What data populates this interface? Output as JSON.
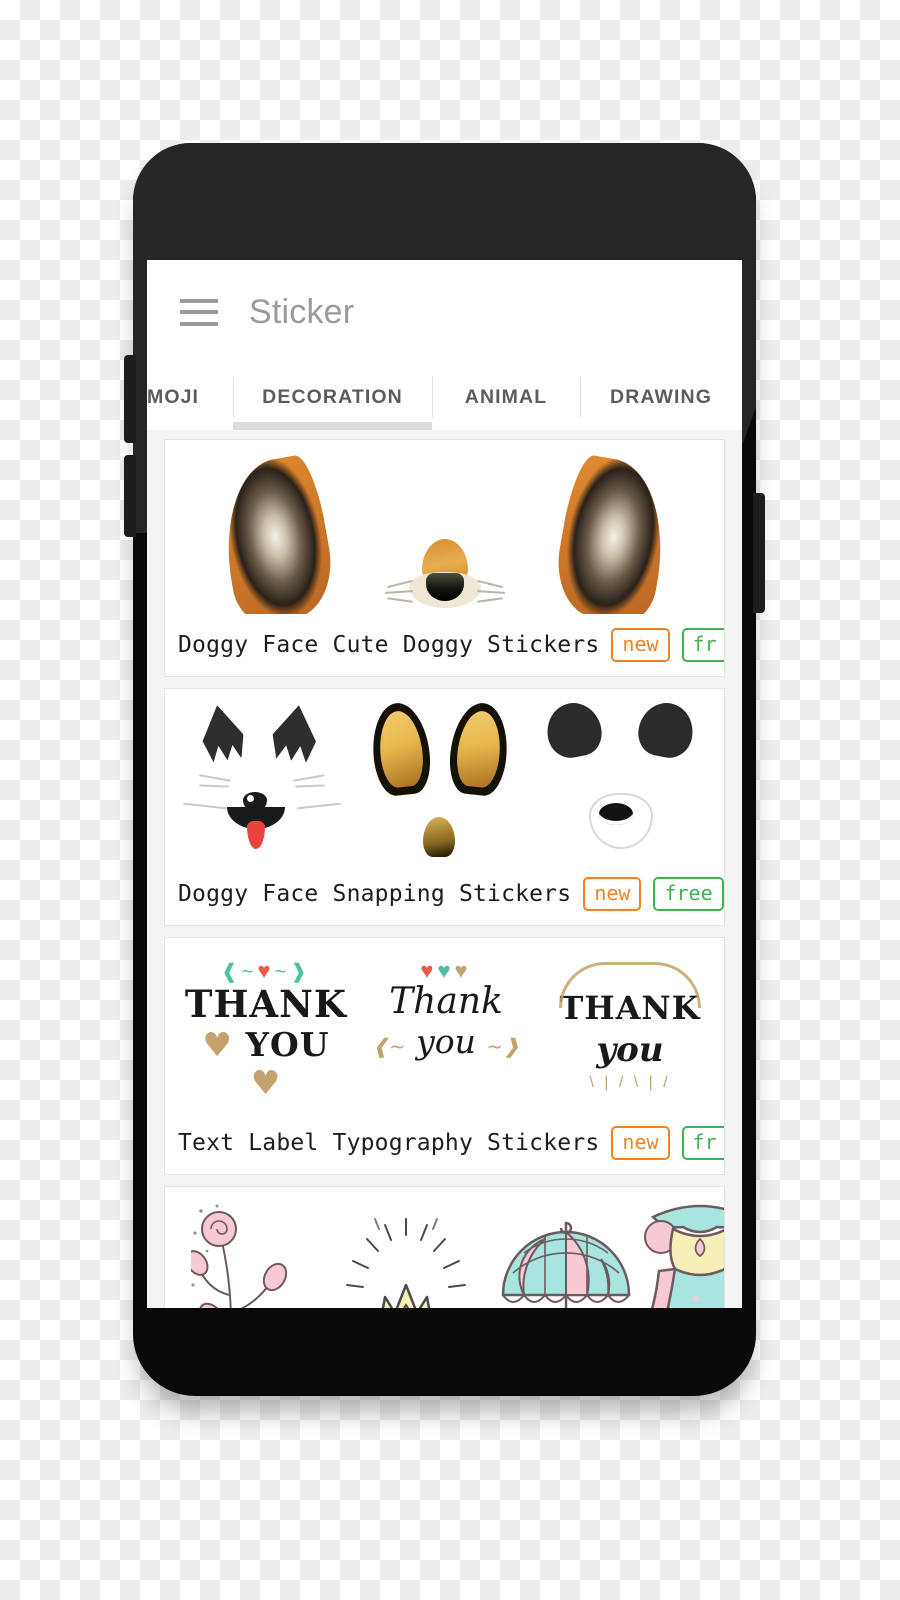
{
  "app": {
    "title": "Sticker",
    "menu_icon": "hamburger-menu-icon"
  },
  "tabs": [
    {
      "label": "MOJI",
      "active": false,
      "truncated": true
    },
    {
      "label": "DECORATION",
      "active": true,
      "truncated": false
    },
    {
      "label": "ANIMAL",
      "active": false,
      "truncated": false
    },
    {
      "label": "DRAWING",
      "active": false,
      "truncated": false
    }
  ],
  "sticker_packs": [
    {
      "title": "Doggy Face Cute Doggy Stickers",
      "badges": [
        {
          "text": "new",
          "color": "#f58220"
        },
        {
          "text": "free",
          "color": "#3eb34f",
          "clipped": true,
          "visible_text": "fr"
        }
      ],
      "art": "fox-ears-and-snout"
    },
    {
      "title": "Doggy Face Snapping Stickers",
      "badges": [
        {
          "text": "new",
          "color": "#f58220"
        },
        {
          "text": "free",
          "color": "#3eb34f",
          "clipped": false,
          "visible_text": "free"
        }
      ],
      "art": "animal-face-sets"
    },
    {
      "title": "Text Label Typography Stickers",
      "badges": [
        {
          "text": "new",
          "color": "#f58220"
        },
        {
          "text": "free",
          "color": "#3eb34f",
          "clipped": true,
          "visible_text": "fr"
        }
      ],
      "art": "thank-you-typography",
      "thank_you_items": [
        {
          "line1": "THANK",
          "line2": "YOU"
        },
        {
          "line1": "Thank",
          "line2": "you"
        },
        {
          "line1": "THANK",
          "line2": "you"
        }
      ]
    },
    {
      "title": "",
      "badges": [],
      "art": "pastel-doodles",
      "doodle_items": [
        "rose",
        "crown",
        "umbrella",
        "dress"
      ]
    }
  ],
  "colors": {
    "badge_new": "#f58220",
    "badge_free": "#3eb34f",
    "app_title": "#9a9a9a",
    "tab_text": "#5c5c5c",
    "tab_indicator": "#dcdcdc",
    "page_bg": "#f4f4f4",
    "card_bg": "#ffffff",
    "device_body": "#090909"
  },
  "device": {
    "type": "smartphone-mockup",
    "buttons": [
      "volume-up",
      "volume-down",
      "power"
    ]
  }
}
